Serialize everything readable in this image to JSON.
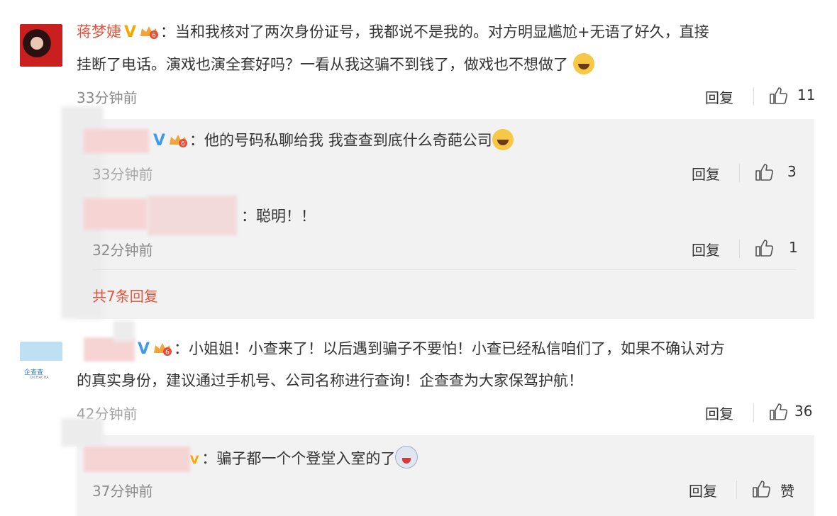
{
  "comments": [
    {
      "author": "蒋梦婕",
      "text_line1": "：当和我核对了两次身份证号，我都说不是我的。对方明显尴尬+无语了好久，直接",
      "text_line2": "挂断了电话。演戏也演全套好吗？一看从我这骗不到钱了，做戏也不想做了",
      "time": "33分钟前",
      "reply_label": "回复",
      "likes": "11"
    },
    {
      "author": "",
      "text_line1": "：小姐姐！小查来了！以后遇到骗子不要怕！小查已经私信咱们了，如果不确认对方",
      "text_line2": "的真实身份，建议通过手机号、公司名称进行查询！企查查为大家保驾护航！",
      "time": "42分钟前",
      "reply_label": "回复",
      "likes": "36",
      "avatar_logo": "企查查",
      "avatar_sub": "QICHACHA"
    }
  ],
  "replies": [
    {
      "text": "：他的号码私聊给我 我查查到底什么奇葩公司",
      "time": "33分钟前",
      "reply_label": "回复",
      "likes": "3"
    },
    {
      "text": "：聪明！！",
      "time": "32分钟前",
      "reply_label": "回复",
      "likes": "1"
    },
    {
      "text": "：骗子都一个个登堂入室的了",
      "time": "37分钟前",
      "reply_label": "回复",
      "likes": "赞"
    }
  ],
  "more_replies": "共7条回复",
  "badge_v": "V",
  "vip_level": "6",
  "colors": {
    "name": "#e3543c",
    "link": "#e3543c",
    "gold_v": "#f7a600",
    "blue_v": "#3d9be9"
  },
  "icons": [
    "verified-v-icon",
    "vip-crown-icon",
    "thumb-up-icon",
    "laughing-emoji-icon",
    "panda-emoji-icon"
  ]
}
